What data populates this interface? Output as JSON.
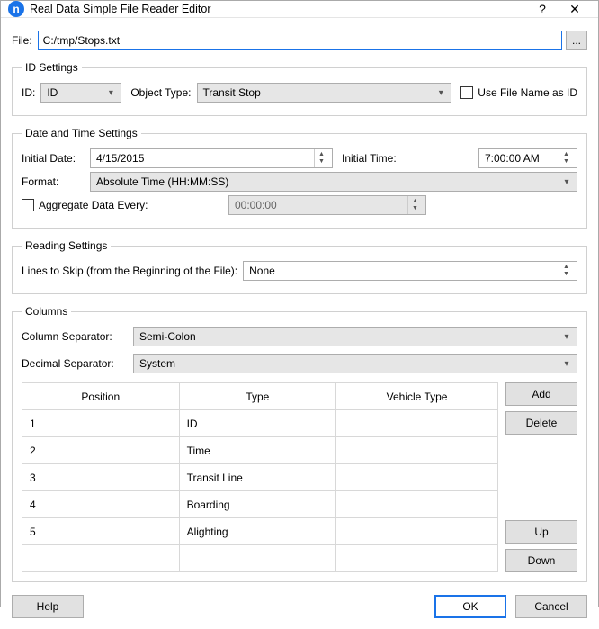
{
  "titlebar": {
    "icon_letter": "n",
    "title": "Real Data Simple File Reader Editor"
  },
  "file": {
    "label": "File:",
    "path": "C:/tmp/Stops.txt",
    "browse": "..."
  },
  "id_settings": {
    "legend": "ID Settings",
    "id_label": "ID:",
    "id_value": "ID",
    "object_type_label": "Object Type:",
    "object_type_value": "Transit Stop",
    "use_filename_label": "Use File Name as ID",
    "use_filename_checked": false
  },
  "date_time": {
    "legend": "Date and Time Settings",
    "initial_date_label": "Initial Date:",
    "initial_date_value": "4/15/2015",
    "initial_time_label": "Initial Time:",
    "initial_time_value": "7:00:00 AM",
    "format_label": "Format:",
    "format_value": "Absolute Time (HH:MM:SS)",
    "aggregate_label": "Aggregate Data Every:",
    "aggregate_checked": false,
    "aggregate_value": "00:00:00"
  },
  "reading": {
    "legend": "Reading Settings",
    "lines_label": "Lines to Skip (from the Beginning of the File):",
    "lines_value": "None"
  },
  "columns": {
    "legend": "Columns",
    "separator_label": "Column Separator:",
    "separator_value": "Semi-Colon",
    "decimal_label": "Decimal Separator:",
    "decimal_value": "System",
    "headers": {
      "position": "Position",
      "type": "Type",
      "vehicle": "Vehicle Type"
    },
    "rows": [
      {
        "position": "1",
        "type": "ID",
        "vehicle": ""
      },
      {
        "position": "2",
        "type": "Time",
        "vehicle": ""
      },
      {
        "position": "3",
        "type": "Transit Line",
        "vehicle": ""
      },
      {
        "position": "4",
        "type": "Boarding",
        "vehicle": ""
      },
      {
        "position": "5",
        "type": "Alighting",
        "vehicle": ""
      }
    ],
    "buttons": {
      "add": "Add",
      "delete": "Delete",
      "up": "Up",
      "down": "Down"
    }
  },
  "footer": {
    "help": "Help",
    "ok": "OK",
    "cancel": "Cancel"
  }
}
